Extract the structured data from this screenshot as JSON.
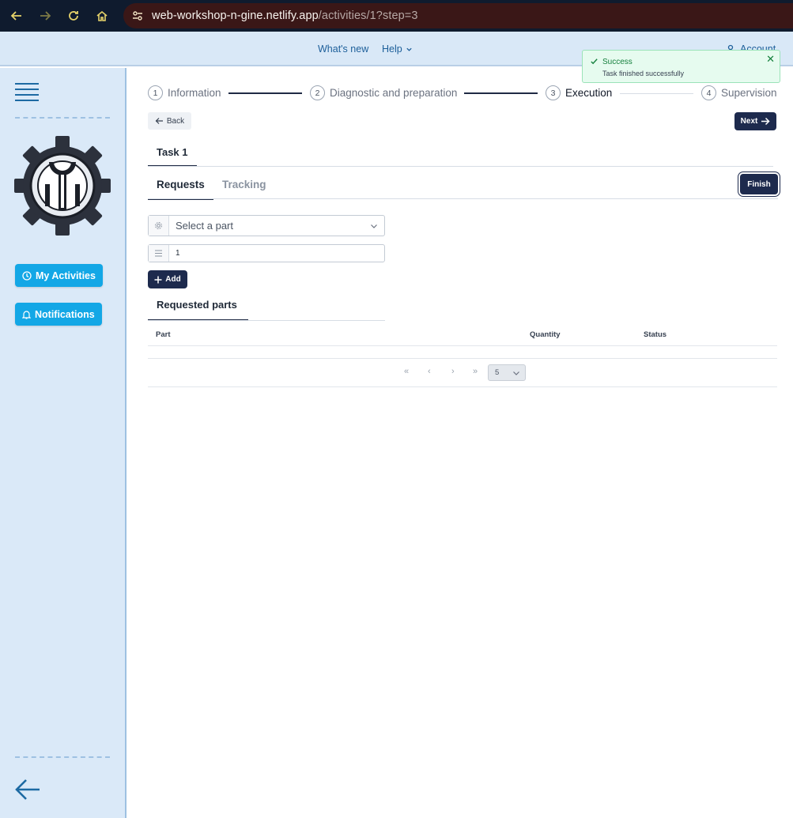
{
  "browser": {
    "url_host": "web-workshop-n-gine.netlify.app",
    "url_path": "/activities/1?step=3"
  },
  "header": {
    "whats_new": "What's new",
    "help": "Help",
    "account": "Account"
  },
  "toast": {
    "title": "Success",
    "message": "Task finished successfully",
    "close": "✕"
  },
  "sidebar": {
    "my_activities": "My Activities",
    "notifications": "Notifications"
  },
  "stepper": {
    "steps": [
      {
        "num": "1",
        "label": "Information"
      },
      {
        "num": "2",
        "label": "Diagnostic and preparation"
      },
      {
        "num": "3",
        "label": "Execution"
      },
      {
        "num": "4",
        "label": "Supervision"
      }
    ]
  },
  "actions": {
    "back": "Back",
    "next": "Next",
    "finish": "Finish",
    "add": "Add"
  },
  "task_tab": "Task 1",
  "tabs": {
    "requests": "Requests",
    "tracking": "Tracking"
  },
  "form": {
    "part_placeholder": "Select a part",
    "quantity": "1"
  },
  "requested_parts": {
    "title": "Requested parts",
    "columns": [
      "Part",
      "Quantity",
      "Status"
    ]
  },
  "pagination": {
    "first": "«",
    "prev": "‹",
    "next": "›",
    "last": "»",
    "page_size": "5"
  },
  "colors": {
    "primary": "#1d2a4d",
    "accent": "#13a7e6",
    "success": "#15803d",
    "sidebar_bg": "#dae9f8"
  }
}
